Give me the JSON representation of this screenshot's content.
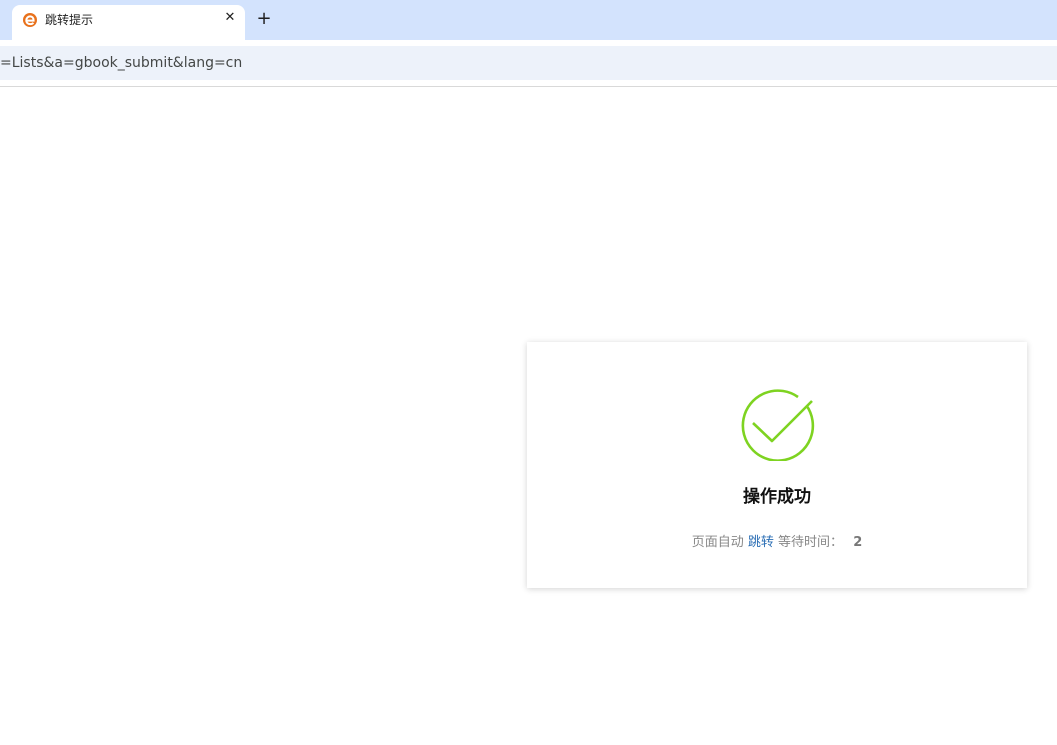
{
  "browser": {
    "tab": {
      "title": "跳转提示",
      "favicon": "edge-e-icon",
      "close_glyph": "✕"
    },
    "new_tab_glyph": "+",
    "address_bar": {
      "url": "=Lists&a=gbook_submit&lang=cn"
    }
  },
  "dialog": {
    "icon": "check-circle-icon",
    "icon_color": "#7ed321",
    "title": "操作成功",
    "info_prefix": "页面自动",
    "jump_link": "跳转",
    "wait_label": "等待时间：",
    "wait_seconds": "2",
    "link_color": "#2c6fb5"
  }
}
